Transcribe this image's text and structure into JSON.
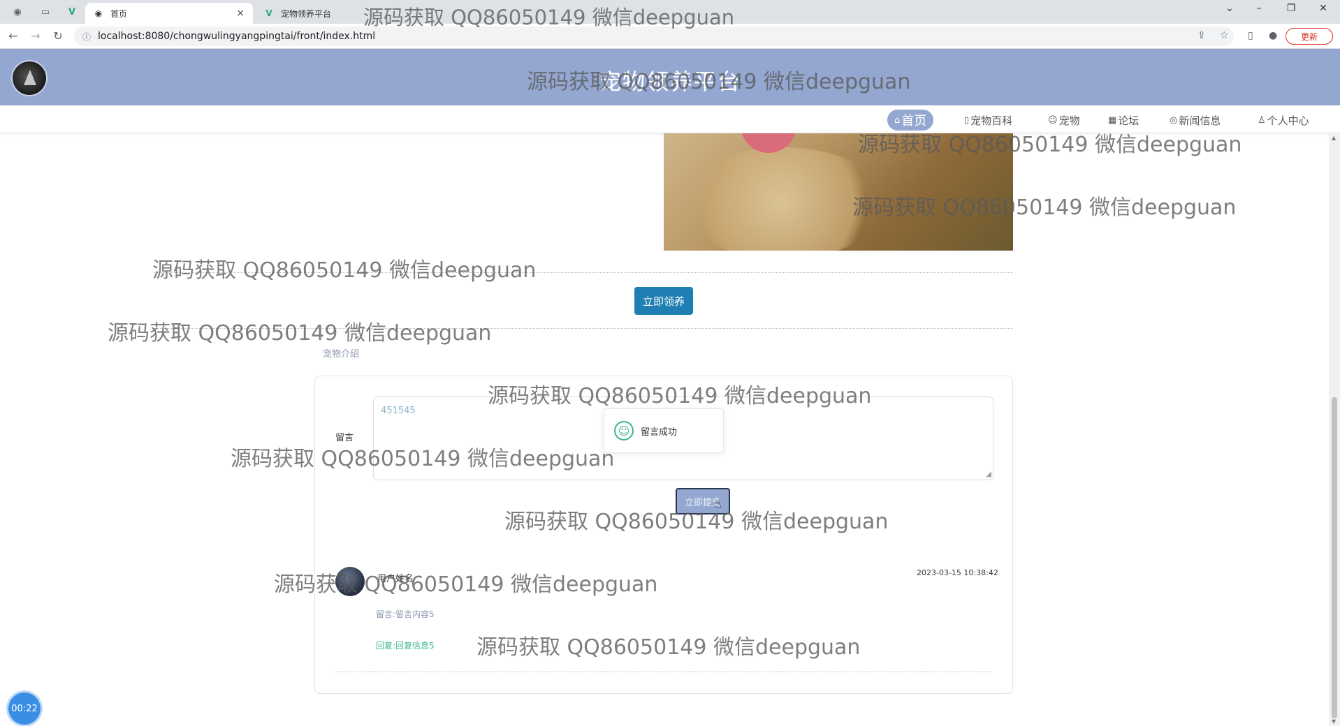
{
  "browser": {
    "tabs": [
      {
        "title": "首页",
        "active": true
      },
      {
        "title": "宠物领养平台",
        "active": false
      }
    ],
    "tab_close": "×",
    "url": "localhost:8080/chongwulingyangpingtai/front/index.html",
    "update_label": "更新"
  },
  "site": {
    "title": "宠物领养平台"
  },
  "nav": {
    "items": [
      {
        "label": "首页",
        "icon": "⌂",
        "active": true
      },
      {
        "label": "宠物百科",
        "icon": "▯"
      },
      {
        "label": "宠物",
        "icon": "☺"
      },
      {
        "label": "论坛",
        "icon": "▦"
      },
      {
        "label": "新闻信息",
        "icon": "◎"
      },
      {
        "label": "个人中心",
        "icon": "♙"
      }
    ]
  },
  "detail": {
    "adopt_button": "立即领养",
    "tabs": {
      "intro": "宠物介绍",
      "message": "留言"
    }
  },
  "message_form": {
    "label": "留言",
    "value": "451545",
    "submit_label": "立即提交"
  },
  "toast": {
    "text": "留言成功"
  },
  "comment": {
    "user": "用户姓名",
    "time": "2023-03-15 10:38:42",
    "content": "留言:留言内容5",
    "reply": "回复:回复信息5"
  },
  "timer": {
    "value": "00:22"
  },
  "watermark": {
    "text": "源码获取 QQ86050149 微信deepguan"
  },
  "colors": {
    "header_bg": "#93a7d1",
    "adopt_button": "#1f7fb3",
    "success": "#3cb88a"
  }
}
